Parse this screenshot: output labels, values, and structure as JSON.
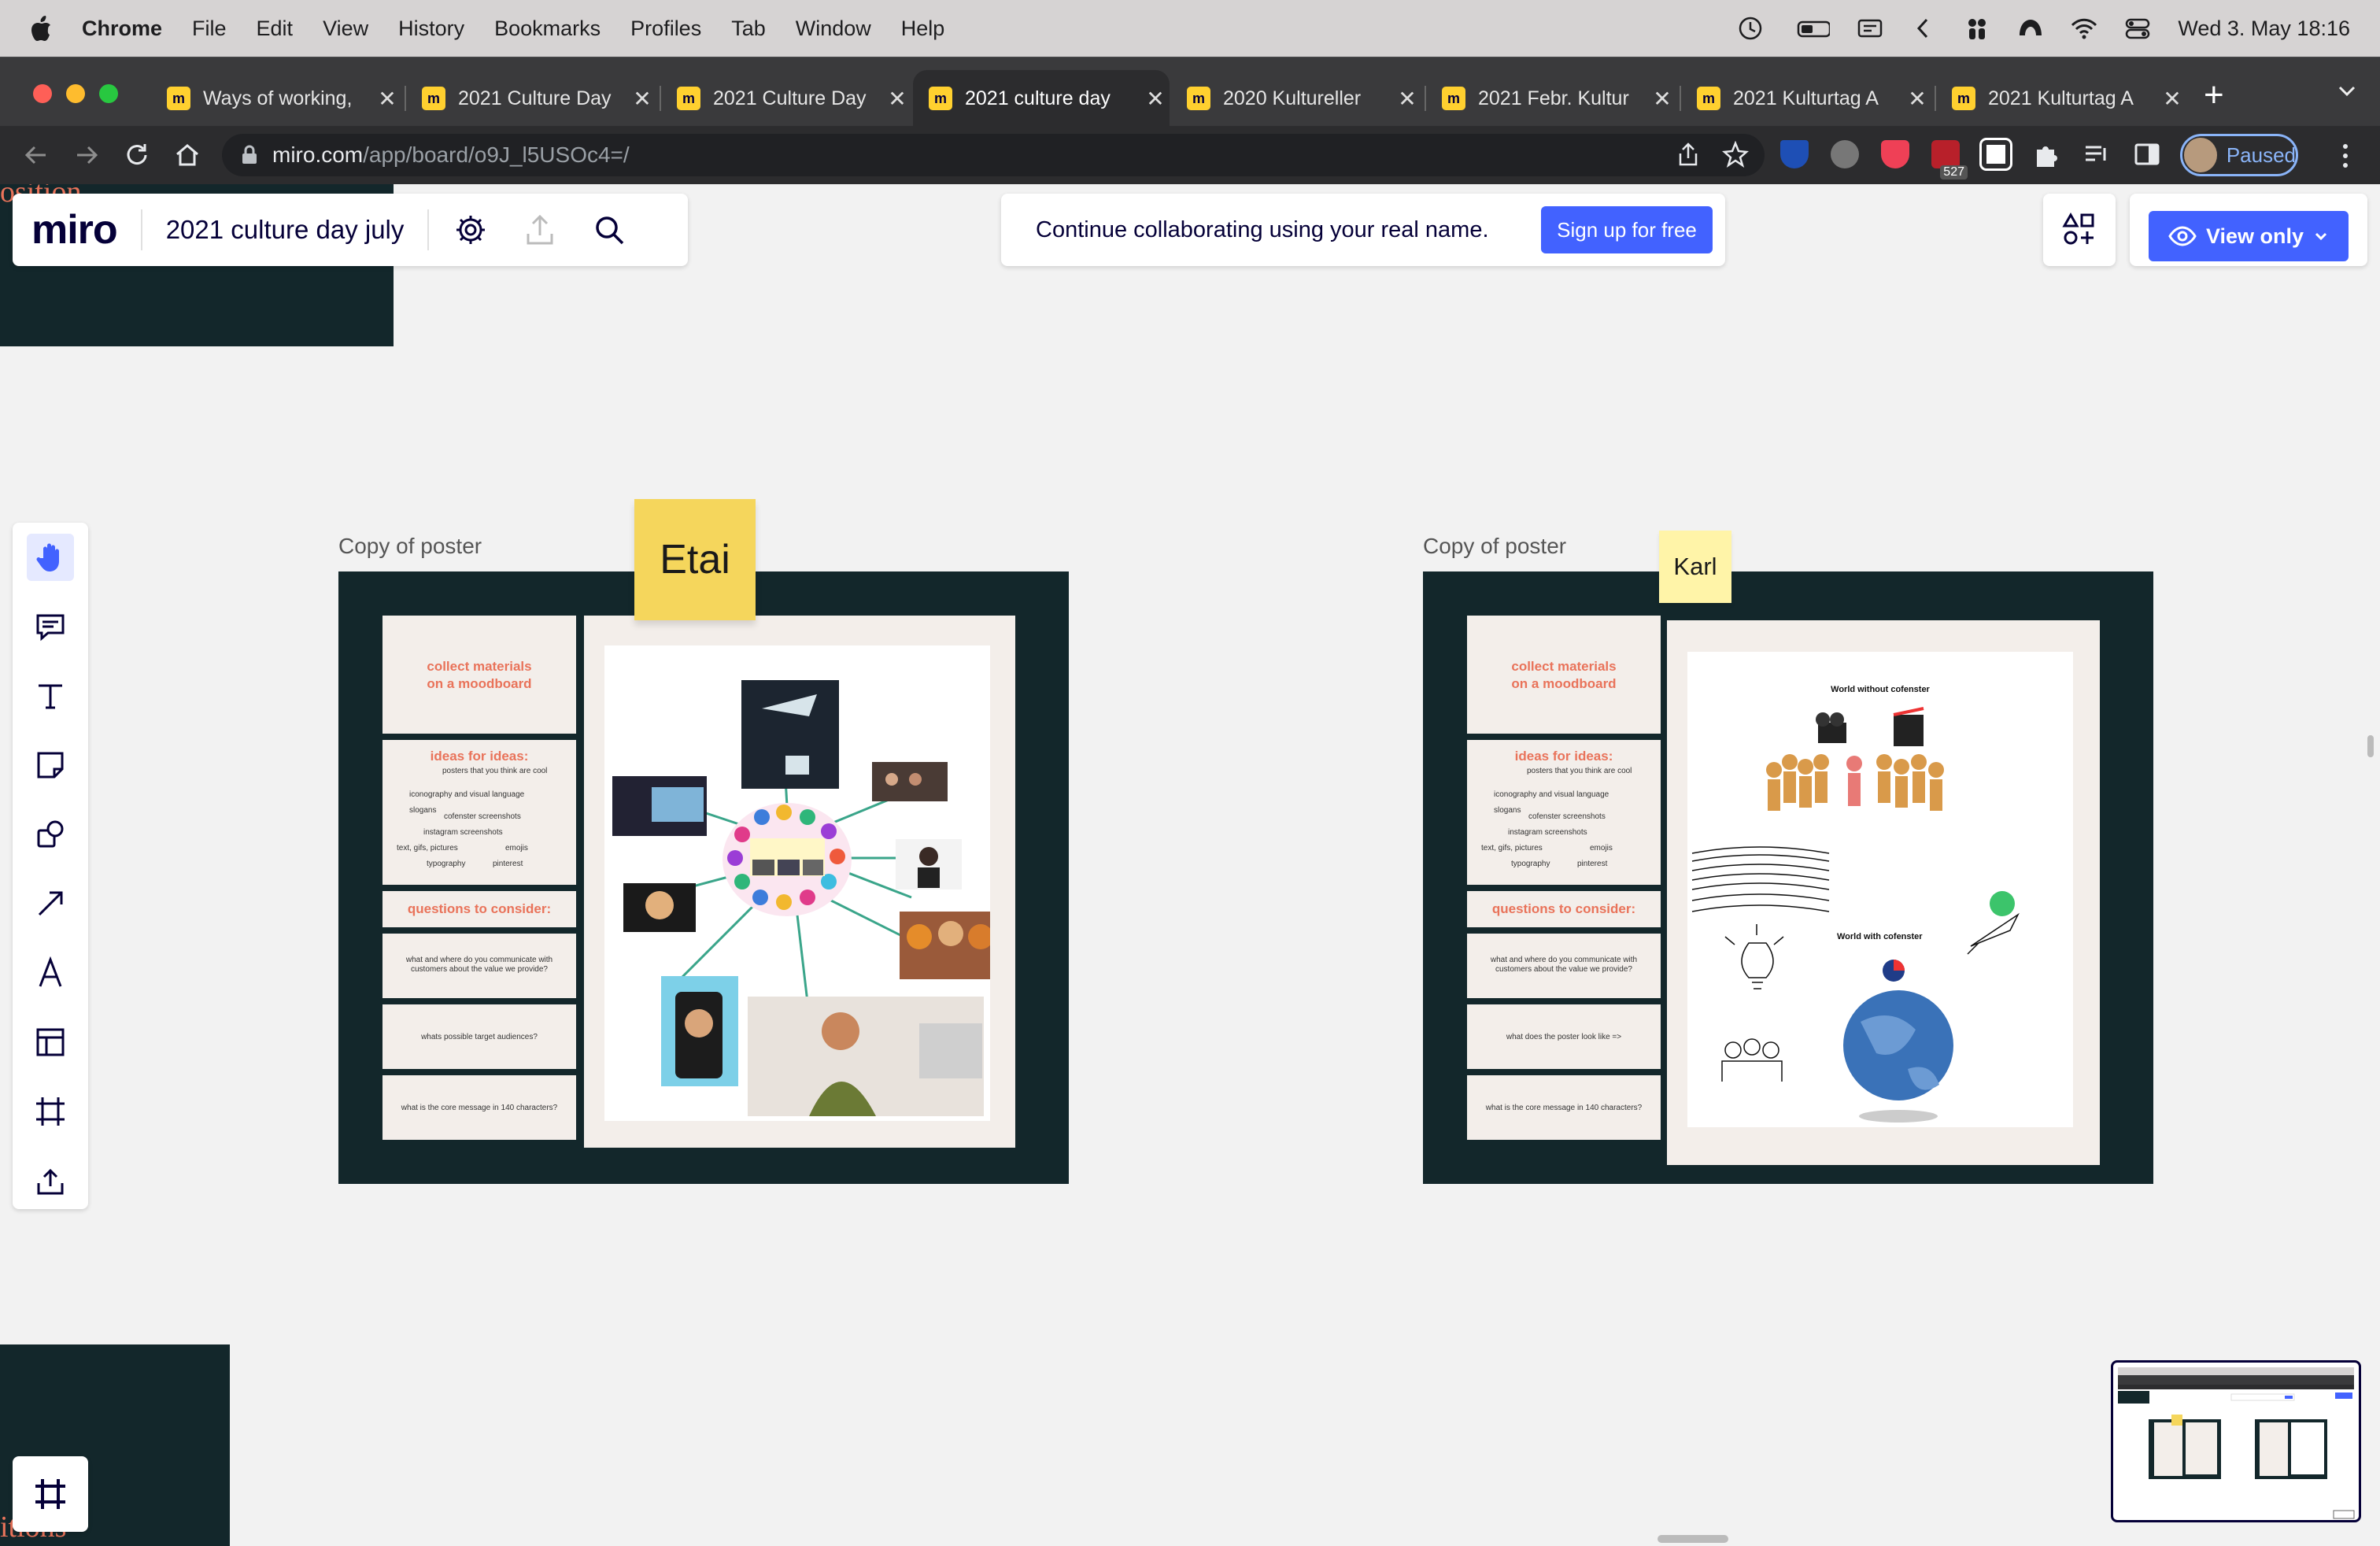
{
  "macos_menubar": {
    "app": "Chrome",
    "menus": [
      "File",
      "Edit",
      "View",
      "History",
      "Bookmarks",
      "Profiles",
      "Tab",
      "Window",
      "Help"
    ],
    "datetime": "Wed 3. May  18:16"
  },
  "browser": {
    "tabs": [
      {
        "title": "Ways of working,"
      },
      {
        "title": "2021 Culture Day"
      },
      {
        "title": "2021 Culture Day"
      },
      {
        "title": "2021 culture day",
        "active": true
      },
      {
        "title": "2020 Kultureller"
      },
      {
        "title": "2021 Febr. Kultur"
      },
      {
        "title": "2021 Kulturtag A"
      },
      {
        "title": "2021 Kulturtag A"
      }
    ],
    "url_host": "miro.com",
    "url_path": "/app/board/o9J_l5USOc4=/",
    "extension_badge": "527",
    "profile_label": "Paused"
  },
  "miro": {
    "logo": "miro",
    "board_title": "2021 culture day july",
    "banner_message": "Continue collaborating using your real name.",
    "signup_label": "Sign up for free",
    "view_only_label": "View only",
    "edge_text_top": "osition",
    "edge_text_bottom": "itions",
    "tools": [
      "hand-tool",
      "comment-tool",
      "text-tool",
      "sticky-note-tool",
      "shapes-tool",
      "connection-line-tool",
      "pen-tool",
      "templates-tool",
      "frame-tool",
      "upload-tool"
    ],
    "frames": [
      {
        "label": "Copy of poster",
        "sticky": "Etai",
        "collect": "collect materials\non a moodboard",
        "ideas_title": "ideas for ideas:",
        "ideas_sub": "posters that you think are cool",
        "ideas_items": [
          "iconography and visual language",
          "slogans",
          "cofenster screenshots",
          "instagram screenshots",
          "text, gifs, pictures",
          "emojis",
          "typography",
          "pinterest"
        ],
        "questions_title": "questions to consider:",
        "q1": "what and where do you communicate with customers about the value we provide?",
        "q2": "whats possible target audiences?",
        "q3": "what is the core message in 140 characters?"
      },
      {
        "label": "Copy of poster",
        "sticky": "Karl",
        "collect": "collect materials\non a moodboard",
        "ideas_title": "ideas for ideas:",
        "ideas_sub": "posters that you think are cool",
        "ideas_items": [
          "iconography and visual language",
          "slogans",
          "cofenster screenshots",
          "instagram screenshots",
          "text, gifs, pictures",
          "emojis",
          "typography",
          "pinterest"
        ],
        "questions_title": "questions to consider:",
        "q1": "what and where do you communicate with customers about the value we provide?",
        "q2": "what does the poster look like =>",
        "q3": "what is the core message in 140 characters?",
        "world_without": "World without cofenster",
        "world_with": "World with cofenster"
      }
    ]
  },
  "colors": {
    "miro_blue": "#4262ff",
    "frame_dark": "#13272b",
    "accent_salmon": "#e9735a",
    "sticky_yellow": "#f5d65c",
    "sticky_light": "#fff4a8"
  }
}
